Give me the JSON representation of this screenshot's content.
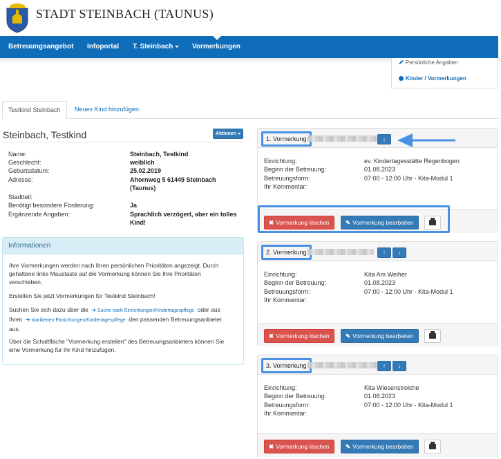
{
  "brand": {
    "title": "STADT STEINBACH (TAUNUS)"
  },
  "nav": {
    "items": [
      {
        "label": "Betreuungsangebot"
      },
      {
        "label": "Infoportal"
      },
      {
        "label": "T. Steinbach"
      },
      {
        "label": "Vormerkungen"
      }
    ]
  },
  "side_menu": {
    "personal": "Persönliche Angaben",
    "kinder": "Kinder / Vormerkungen"
  },
  "tabs": {
    "active": "Testkind Steinbach",
    "add": "Neues Kind hinzufügen"
  },
  "child": {
    "heading": "Steinbach, Testkind",
    "actions_label": "Aktionen",
    "fields": [
      {
        "label": "Name:",
        "value": "Steinbach, Testkind"
      },
      {
        "label": "Geschlecht:",
        "value": "weiblich"
      },
      {
        "label": "Geburtsdatum:",
        "value": "25.02.2019"
      },
      {
        "label": "Adresse:",
        "value": "Ahornweg 5 61449 Steinbach"
      },
      {
        "label": "",
        "value": "(Taunus)"
      },
      {
        "label": "Stadtteil:",
        "value": ""
      },
      {
        "label": "Benötigt besondere Förderung:",
        "value": "Ja"
      },
      {
        "label": "Ergänzende Angaben:",
        "value": "Sprachlich verzögert, aber ein tolles"
      },
      {
        "label": "",
        "value": "Kind!"
      }
    ]
  },
  "info": {
    "title": "Informationen",
    "p1_line1": "Ihre Vormerkungen werden nach Ihren persönlichen Prioritäten angezeigt. Durch",
    "p1_line2": "gehaltene linke Maustaste auf die Vormerkung können Sie Ihre Prioritäten",
    "p1_line3": "verschieben.",
    "p2": "Erstellen Sie jetzt Vormerkungen für Testkind Steinbach!",
    "p3_pre": "Suchen Sie sich dazu über die",
    "p3_link1": "Suche nach Einrichtungen/Kindertagespflege",
    "p3_mid": "oder aus",
    "p3_pre2": "Ihren",
    "p3_link2": "markierten Einrichtungen/Kindertagespflege",
    "p3_post": "den passenden Betreuungsanbieter",
    "p3_end": "aus.",
    "p4_line1": "Über die Schaltfläche \"Vormerkung erstellen\" des Betreuungsanbieters können Sie",
    "p4_line2": "eine Vormerkung für Ihr Kind hinzufügen."
  },
  "vormerkungen": {
    "labels": {
      "einrichtung": "Einrichtung:",
      "beginn": "Beginn der Betreuung:",
      "form": "Betreuungsform:",
      "kommentar": "Ihr Kommentar:"
    },
    "delete_label": "Vormerkung löschen",
    "edit_label": "Vormerkung bearbeiten",
    "items": [
      {
        "title": "1. Vormerkung",
        "einrichtung": "ev. Kindertagesstätte Regenbogen",
        "beginn": "01.08.2023",
        "form": "07:00 - 12:00 Uhr - Kita-Modul 1",
        "kommentar": ""
      },
      {
        "title": "2. Vormerkung",
        "einrichtung": "Kita Am Weiher",
        "beginn": "01.08.2023",
        "form": "07:00 - 12:00 Uhr - Kita-Modul 1",
        "kommentar": ""
      },
      {
        "title": "3. Vormerkung",
        "einrichtung": "Kita Wiesenstrolche",
        "beginn": "01.08.2023",
        "form": "07:00 - 12:00 Uhr - Kita-Modul 1",
        "kommentar": ""
      }
    ]
  },
  "colors": {
    "navbar": "#0e6cb8",
    "highlight": "#4a90e2",
    "danger": "#d9534f",
    "primary": "#337ab7"
  },
  "icons": [
    "crest-logo",
    "caret-down-icon",
    "pencil-icon",
    "info-circle-icon",
    "arrow-up-icon",
    "arrow-down-icon",
    "times-icon",
    "printer-icon",
    "arrow-right-icon"
  ]
}
